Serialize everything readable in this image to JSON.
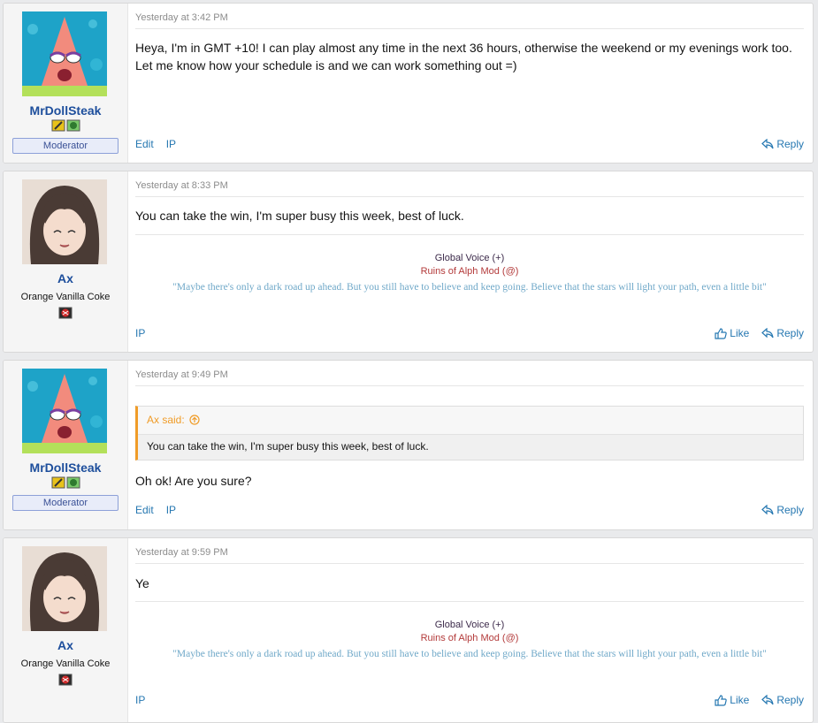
{
  "posts": [
    {
      "username": "MrDollSteak",
      "banner": "Moderator",
      "timestamp": "Yesterday at 3:42 PM",
      "body": "Heya, I'm in GMT +10! I can play almost any time in the next 36 hours, otherwise the weekend or my evenings work too. Let me know how your schedule is and we can work something out =)",
      "actions_left": [
        "Edit",
        "IP"
      ],
      "actions_right": [
        "Reply"
      ]
    },
    {
      "username": "Ax",
      "user_title": "Orange Vanilla Coke",
      "timestamp": "Yesterday at 8:33 PM",
      "body": "You can take the win, I'm super busy this week, best of luck.",
      "signature": {
        "line1": "Global Voice (+)",
        "line2": "Ruins of Alph Mod (@)",
        "quote": "\"Maybe there's only a dark road up ahead. But you still have to believe and keep going. Believe that the stars will light your path, even a little bit\""
      },
      "actions_left": [
        "IP"
      ],
      "actions_right": [
        "Like",
        "Reply"
      ]
    },
    {
      "username": "MrDollSteak",
      "banner": "Moderator",
      "timestamp": "Yesterday at 9:49 PM",
      "quote": {
        "author": "Ax said:",
        "text": "You can take the win, I'm super busy this week, best of luck."
      },
      "body": "Oh ok! Are you sure?",
      "actions_left": [
        "Edit",
        "IP"
      ],
      "actions_right": [
        "Reply"
      ]
    },
    {
      "username": "Ax",
      "user_title": "Orange Vanilla Coke",
      "timestamp": "Yesterday at 9:59 PM",
      "body": "Ye",
      "signature": {
        "line1": "Global Voice (+)",
        "line2": "Ruins of Alph Mod (@)",
        "quote": "\"Maybe there's only a dark road up ahead. But you still have to believe and keep going. Believe that the stars will light your path, even a little bit\""
      },
      "actions_left": [
        "IP"
      ],
      "actions_right": [
        "Like",
        "Reply"
      ]
    }
  ],
  "colors": {
    "username": "#1d4e9c",
    "link": "#2577b1",
    "quote_accent": "#f09c28",
    "sig_mod": "#b33a3a",
    "sig_quote": "#6fa8c8"
  }
}
